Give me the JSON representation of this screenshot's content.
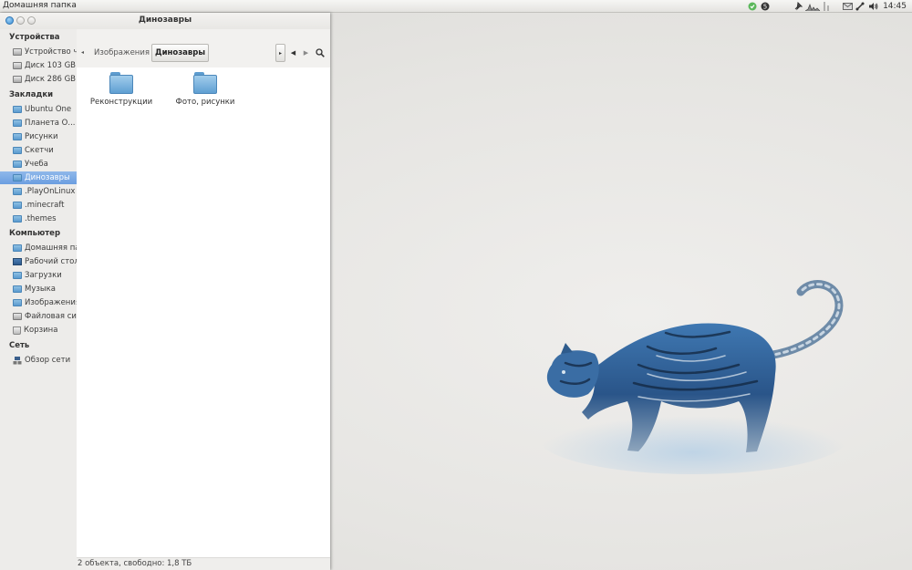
{
  "panel": {
    "app_title": "Домашняя папка",
    "clock": "14:45",
    "tray_icons": [
      "ubuntu-one-icon",
      "skype-icon",
      "pin-icon",
      "system-monitor-icon",
      "mail-icon",
      "network-icon",
      "volume-icon"
    ]
  },
  "window": {
    "title": "Динозавры",
    "buttons": [
      "close-icon",
      "minimize-icon",
      "maximize-icon"
    ]
  },
  "sidebar": {
    "sections": [
      {
        "title": "Устройства",
        "items": [
          {
            "label": "Устройство чтения",
            "icon": "drive-icon"
          },
          {
            "label": "Диск 103 GB",
            "icon": "drive-icon"
          },
          {
            "label": "Диск 286 GB",
            "icon": "drive-icon"
          }
        ]
      },
      {
        "title": "Закладки",
        "items": [
          {
            "label": "Ubuntu One",
            "icon": "folder-icon"
          },
          {
            "label": "Планета О...",
            "icon": "folder-icon"
          },
          {
            "label": "Рисунки",
            "icon": "folder-icon"
          },
          {
            "label": "Скетчи",
            "icon": "folder-icon"
          },
          {
            "label": "Учеба",
            "icon": "folder-icon"
          },
          {
            "label": "Динозавры",
            "icon": "folder-icon",
            "selected": true
          },
          {
            "label": ".PlayOnLinux",
            "icon": "folder-icon"
          },
          {
            "label": ".minecraft",
            "icon": "folder-icon"
          },
          {
            "label": ".themes",
            "icon": "folder-icon"
          }
        ]
      },
      {
        "title": "Компьютер",
        "items": [
          {
            "label": "Домашняя папка",
            "icon": "home-folder-icon"
          },
          {
            "label": "Рабочий стол",
            "icon": "desktop-icon"
          },
          {
            "label": "Загрузки",
            "icon": "downloads-folder-icon"
          },
          {
            "label": "Музыка",
            "icon": "music-folder-icon"
          },
          {
            "label": "Изображения",
            "icon": "pictures-folder-icon"
          },
          {
            "label": "Файловая система",
            "icon": "filesystem-icon"
          },
          {
            "label": "Корзина",
            "icon": "trash-icon"
          }
        ]
      },
      {
        "title": "Сеть",
        "items": [
          {
            "label": "Обзор сети",
            "icon": "network-icon"
          }
        ]
      }
    ]
  },
  "pathbar": {
    "crumbs": [
      "Изображения",
      "Динозавры"
    ]
  },
  "content": {
    "items": [
      {
        "label": "Реконструкции",
        "icon": "folder-icon"
      },
      {
        "label": "Фото, рисунки",
        "icon": "folder-icon"
      }
    ]
  },
  "status": {
    "text": "2 объекта, свободно: 1,8 ТБ"
  },
  "colors": {
    "accent_selection": "#7aa8e4",
    "folder_blue": "#6fa9d6"
  }
}
